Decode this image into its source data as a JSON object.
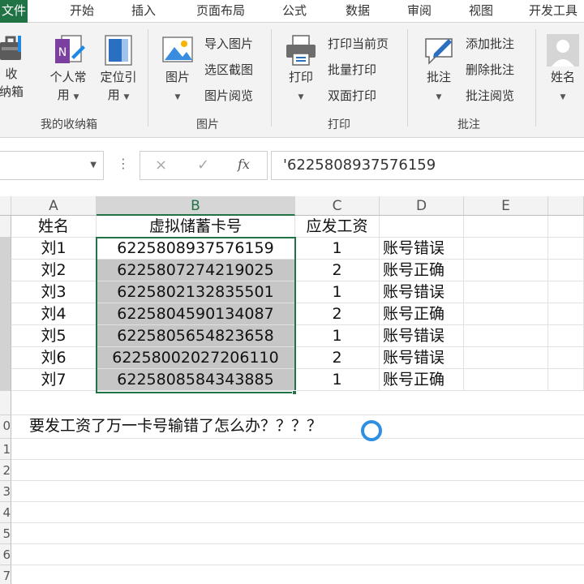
{
  "tabs": [
    "文件",
    "开始",
    "插入",
    "页面布局",
    "公式",
    "数据",
    "审阅",
    "视图",
    "开发工具"
  ],
  "ribbon": {
    "toolbox": {
      "label_line1": "收",
      "label_line2": "纳箱"
    },
    "personal": {
      "label_line1": "个人常",
      "label_line2": "用"
    },
    "locate": {
      "label_line1": "定位引",
      "label_line2": "用"
    },
    "group_mytoolbox": "我的收纳箱",
    "picture_btn": "图片",
    "import_picture": "导入图片",
    "region_screenshot": "选区截图",
    "picture_browse": "图片阅览",
    "group_picture": "图片",
    "print_btn": "打印",
    "print_current": "打印当前页",
    "batch_print": "批量打印",
    "duplex_print": "双面打印",
    "group_print": "打印",
    "comment_btn": "批注",
    "add_comment": "添加批注",
    "delete_comment": "删除批注",
    "comment_browse": "批注阅览",
    "group_comment": "批注",
    "name_btn": "姓名"
  },
  "formula_bar": {
    "cancel": "×",
    "enter": "✓",
    "fx": "fx",
    "value": "'6225808937576159"
  },
  "columns": [
    "A",
    "B",
    "C",
    "D",
    "E"
  ],
  "table": {
    "headers": [
      "姓名",
      "虚拟储蓄卡号",
      "应发工资"
    ],
    "rows": [
      {
        "name": "刘1",
        "card": "6225808937576159",
        "salary": "1",
        "status": "账号错误"
      },
      {
        "name": "刘2",
        "card": "6225807274219025",
        "salary": "2",
        "status": "账号正确"
      },
      {
        "name": "刘3",
        "card": "6225802132835501",
        "salary": "1",
        "status": "账号错误"
      },
      {
        "name": "刘4",
        "card": "6225804590134087",
        "salary": "2",
        "status": "账号正确"
      },
      {
        "name": "刘5",
        "card": "6225805654823658",
        "salary": "1",
        "status": "账号错误"
      },
      {
        "name": "刘6",
        "card": "62258002027206110",
        "salary": "2",
        "status": "账号错误"
      },
      {
        "name": "刘7",
        "card": "6225808584343885",
        "salary": "1",
        "status": "账号正确"
      }
    ]
  },
  "note": "要发工资了万一卡号输错了怎么办？？？？",
  "row_numbers": [
    "0",
    "1",
    "2",
    "3",
    "4",
    "5",
    "6",
    "7"
  ],
  "colors": {
    "accent": "#217346",
    "selected_fill": "#c6c6c6",
    "cursor_ring": "#2f8fe0"
  }
}
